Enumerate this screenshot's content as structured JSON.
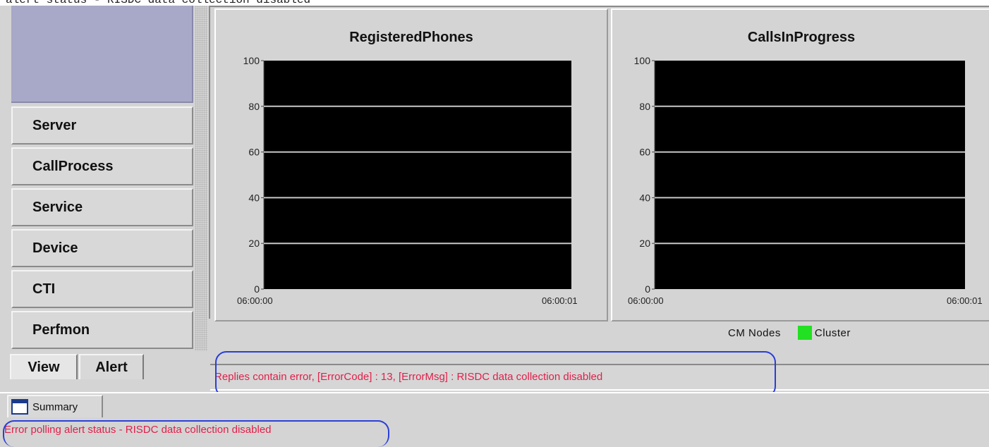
{
  "window": {
    "partial_title": "alert status - RISDC data collection disabled"
  },
  "sidebar": {
    "nav_buttons": [
      "Server",
      "CallProcess",
      "Service",
      "Device",
      "CTI",
      "Perfmon"
    ],
    "tabs": [
      "View",
      "Alert"
    ]
  },
  "charts": [
    {
      "title": "RegisteredPhones",
      "x_start": "06:00:00",
      "x_end": "06:00:01",
      "y_ticks": [
        "100",
        "80",
        "60",
        "40",
        "20",
        "0"
      ]
    },
    {
      "title": "CallsInProgress",
      "x_start": "06:00:00",
      "x_end": "06:00:01",
      "y_ticks": [
        "100",
        "80",
        "60",
        "40",
        "20",
        "0"
      ]
    }
  ],
  "chart_data": [
    {
      "type": "line",
      "title": "RegisteredPhones",
      "x": [
        "06:00:00",
        "06:00:01"
      ],
      "ylim": [
        0,
        100
      ],
      "yticks": [
        0,
        20,
        40,
        60,
        80,
        100
      ],
      "series": [],
      "plot_background": "#000000",
      "grid": true
    },
    {
      "type": "line",
      "title": "CallsInProgress",
      "x": [
        "06:00:00",
        "06:00:01"
      ],
      "ylim": [
        0,
        100
      ],
      "yticks": [
        0,
        20,
        40,
        60,
        80,
        100
      ],
      "series": [],
      "plot_background": "#000000",
      "grid": true
    }
  ],
  "legend": {
    "label": "CM Nodes",
    "items": [
      {
        "name": "Cluster",
        "color": "#22e022"
      }
    ]
  },
  "status": {
    "message": "Replies contain error, [ErrorCode] : 13, [ErrorMsg] : RISDC data collection disabled"
  },
  "bottom": {
    "summary_tab": "Summary",
    "footer_message": "Error polling alert status - RISDC data collection disabled"
  },
  "colors": {
    "error_text": "#e0204a",
    "highlight": "#2a3ed8",
    "plot_bg": "#000000",
    "cluster": "#22e022"
  },
  "icons": {
    "summary": "window-icon"
  }
}
